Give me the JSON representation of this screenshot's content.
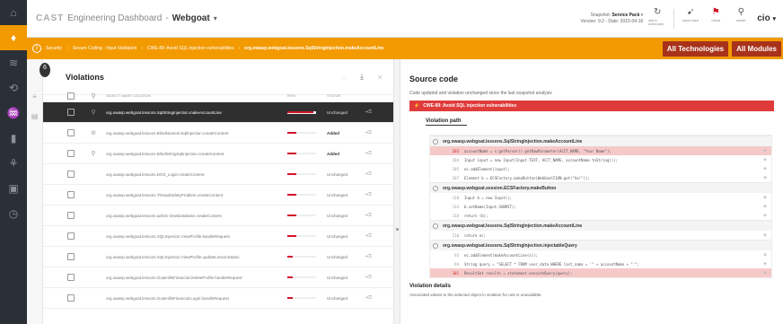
{
  "header": {
    "logo_text": "CAST",
    "app_name": "Engineering Dashboard",
    "app_current": "Webgoat",
    "snapshot_label": "Snapshot:",
    "snapshot_value": "Service Pack",
    "version_line": "Version: 9.2 - Date: 2015-04-16",
    "user": "cio"
  },
  "toolbar": [
    {
      "icon": "refresh-icon",
      "label": "add to action plan"
    },
    {
      "icon": "send-icon",
      "label": "report issue"
    },
    {
      "icon": "flag-icon",
      "label": "critical"
    },
    {
      "icon": "search-icon",
      "label": "search"
    }
  ],
  "breadcrumb": {
    "items": [
      "Security",
      "Secure Coding - Input Validation",
      "CWE-89: Avoid SQL injection vulnerabilities"
    ],
    "current": "org.owasp.webgoat.lessons.SqlStringInjection.makeAccountLine"
  },
  "orange_actions": [
    "All Technologies",
    "All Modules"
  ],
  "violations": {
    "title": "Violations",
    "columns": [
      "OBJECT NAME LOCATION",
      "RISK",
      "STATUS"
    ],
    "rows": [
      {
        "name": "org.owasp.webgoat.lessons.SqlStringInjection.makeAccountLine",
        "risk": 0.9,
        "status": "Unchanged",
        "added": false,
        "icon": "⚲"
      },
      {
        "name": "org.owasp.webgoat.lessons.BlindNumericSqlInjection.createContent",
        "risk": 0.3,
        "status": "Added",
        "added": true,
        "icon": "⊘"
      },
      {
        "name": "org.owasp.webgoat.lessons.BlindStringSqlInjection.createContent",
        "risk": 0.3,
        "status": "Added",
        "added": true,
        "icon": "⚲"
      },
      {
        "name": "org.owasp.webgoat.lessons.DOS_Login.createContent",
        "risk": 0.3,
        "status": "Unchanged",
        "added": false,
        "icon": ""
      },
      {
        "name": "org.owasp.webgoat.lessons.ThreadSafetyProblem.createContent",
        "risk": 0.3,
        "status": "Unchanged",
        "added": false,
        "icon": ""
      },
      {
        "name": "org.owasp.webgoat.lessons.admin.ViewDatabase.createContent",
        "risk": 0.3,
        "status": "Unchanged",
        "added": false,
        "icon": ""
      },
      {
        "name": "org.owasp.webgoat.lessons.SQLInjection.ViewProfile.handleRequest",
        "risk": 0.3,
        "status": "Unchanged",
        "added": false,
        "icon": ""
      },
      {
        "name": "org.owasp.webgoat.lessons.SQLInjection.ViewProfile.updateLessonStatus",
        "risk": 0.2,
        "status": "Unchanged",
        "added": false,
        "icon": ""
      },
      {
        "name": "org.owasp.webgoat.lessons.GoatHillsFinancial.DeleteProfile.handleRequest",
        "risk": 0.2,
        "status": "Unchanged",
        "added": false,
        "icon": ""
      },
      {
        "name": "org.owasp.webgoat.lessons.GoatHillsFinancial.Login.handleRequest",
        "risk": 0.2,
        "status": "Unchanged",
        "added": false,
        "icon": ""
      }
    ]
  },
  "source": {
    "title": "Source code",
    "subtitle": "Code updated and violation unchanged since the last snapshot analysis",
    "rule": "CWE-89: Avoid SQL injection vulnerabilities",
    "path_tab": "Violation path",
    "blocks": [
      {
        "title": "org.owasp.webgoat.lessons.SqlStringInjection.makeAccountLine",
        "lines": [
          {
            "n": "203",
            "t": "accountName = s.getParser().getRawParameter(ACCT_NAME, \"Your Name\");",
            "hl": true
          },
          {
            "n": "204",
            "t": "Input input = new Input(Input.TEXT, ACCT_NAME, accountName.toString());",
            "hl": false
          },
          {
            "n": "205",
            "t": "ec.addElement(input);",
            "hl": false
          },
          {
            "n": "207",
            "t": "Element b = ECSFactory.makeButton(WebGoatI18N.get(\"Go!\"));",
            "hl": false
          }
        ]
      },
      {
        "title": "org.owasp.webgoat.session.ECSFactory.makeButton",
        "lines": [
          {
            "n": "110",
            "t": "Input b = new Input();",
            "hl": false
          },
          {
            "n": "114",
            "t": "b.setName(Input.SUBMIT);",
            "hl": false
          },
          {
            "n": "118",
            "t": "return (b);",
            "hl": false
          }
        ]
      },
      {
        "title": "org.owasp.webgoat.lessons.SqlStringInjection.makeAccountLine",
        "lines": [
          {
            "n": "210",
            "t": "return ec;",
            "hl": false
          }
        ]
      },
      {
        "title": "org.owasp.webgoat.lessons.SqlStringInjection.injectableQuery",
        "lines": [
          {
            "n": "92",
            "t": "ec.addElement(makeAccountLine(s));",
            "hl": false
          },
          {
            "n": "94",
            "t": "String query = \"SELECT * FROM user_data WHERE last_name = '\" + accountName + \"'\";",
            "hl": false
          },
          {
            "n": "101",
            "t": "ResultSet results = statement.executeQuery(query);",
            "hl": true
          }
        ]
      }
    ],
    "details_title": "Violation details",
    "details_sub": "Associated values to the selected object in violation for rule is unavailable."
  }
}
